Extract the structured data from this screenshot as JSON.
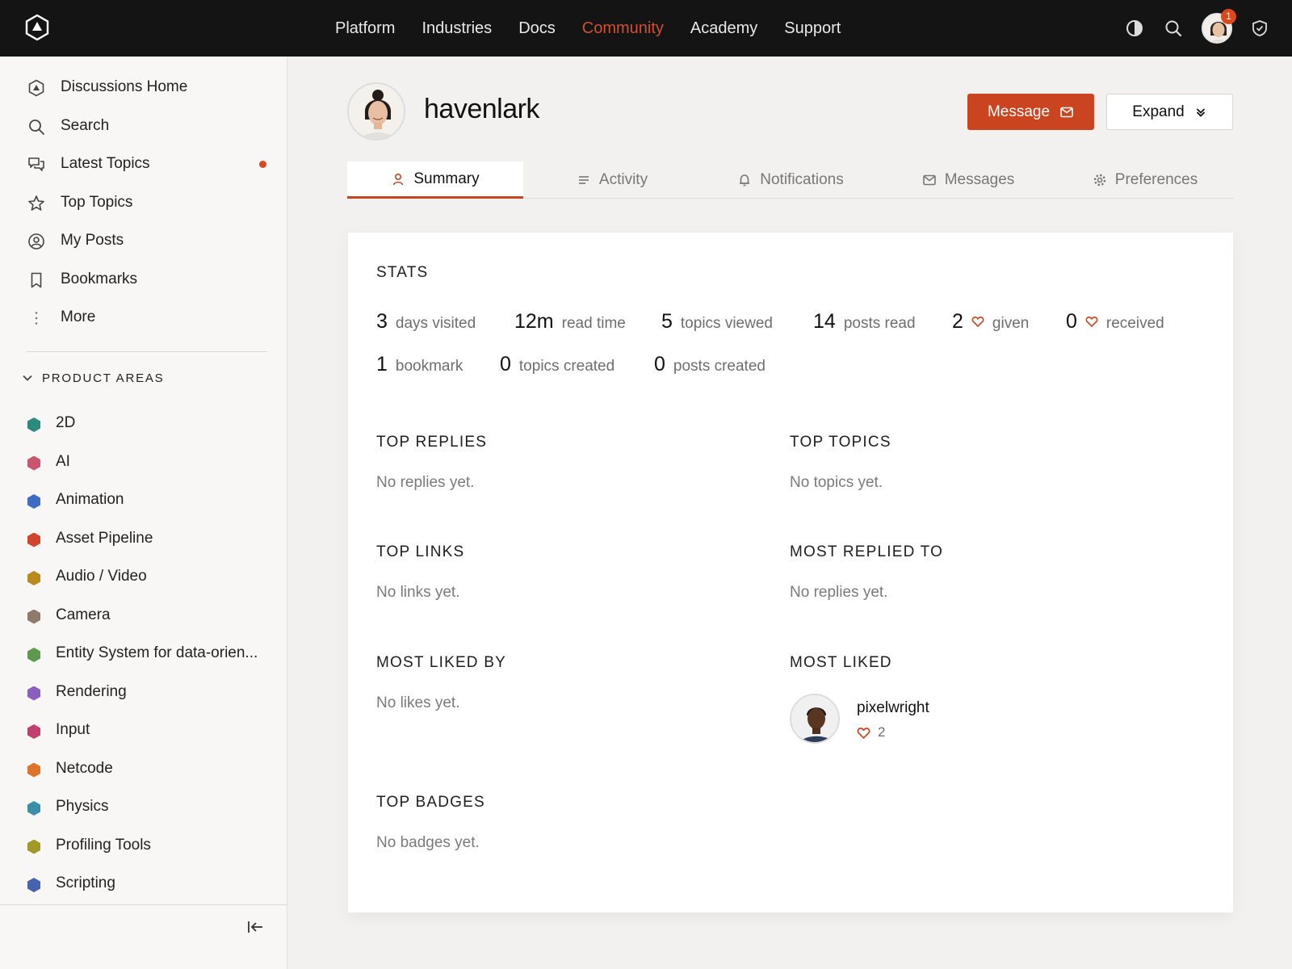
{
  "topnav": {
    "items": [
      "Platform",
      "Industries",
      "Docs",
      "Community",
      "Academy",
      "Support"
    ],
    "active": "Community",
    "notification_count": "1"
  },
  "sidebar": {
    "nav": [
      {
        "label": "Discussions Home",
        "icon": "discussions-home-icon"
      },
      {
        "label": "Search",
        "icon": "search-icon"
      },
      {
        "label": "Latest Topics",
        "icon": "chat-bubbles-icon"
      },
      {
        "label": "Top Topics",
        "icon": "star-icon"
      },
      {
        "label": "My Posts",
        "icon": "user-circle-icon"
      },
      {
        "label": "Bookmarks",
        "icon": "bookmark-icon"
      },
      {
        "label": "More",
        "icon": "more-vertical-icon"
      }
    ],
    "section_title": "PRODUCT AREAS",
    "categories": [
      {
        "label": "2D",
        "color": "#2a8a7b"
      },
      {
        "label": "AI",
        "color": "#c9556f"
      },
      {
        "label": "Animation",
        "color": "#3f6bc2"
      },
      {
        "label": "Asset Pipeline",
        "color": "#d0452c"
      },
      {
        "label": "Audio / Video",
        "color": "#b98a1e"
      },
      {
        "label": "Camera",
        "color": "#8f7b6b"
      },
      {
        "label": "Entity System for data-orien...",
        "color": "#5e9a4c"
      },
      {
        "label": "Rendering",
        "color": "#8a5fc0"
      },
      {
        "label": "Input",
        "color": "#c03f6e"
      },
      {
        "label": "Netcode",
        "color": "#e0732a"
      },
      {
        "label": "Physics",
        "color": "#3a8fa6"
      },
      {
        "label": "Profiling Tools",
        "color": "#a19a27"
      },
      {
        "label": "Scripting",
        "color": "#4763ad"
      }
    ]
  },
  "profile": {
    "username": "havenlark",
    "message_label": "Message",
    "expand_label": "Expand"
  },
  "tabs": [
    "Summary",
    "Activity",
    "Notifications",
    "Messages",
    "Preferences"
  ],
  "stats": {
    "title": "STATS",
    "row1": [
      {
        "n": "3",
        "label": "days visited"
      },
      {
        "n": "12m",
        "label": "read time"
      },
      {
        "n": "5",
        "label": "topics viewed"
      },
      {
        "n": "14",
        "label": "posts read"
      },
      {
        "n": "2",
        "label": "given",
        "heart": true
      },
      {
        "n": "0",
        "label": "received",
        "heart": true
      }
    ],
    "row2": [
      {
        "n": "1",
        "label": "bookmark"
      },
      {
        "n": "0",
        "label": "topics created"
      },
      {
        "n": "0",
        "label": "posts created"
      }
    ]
  },
  "sections": {
    "top_replies": {
      "title": "TOP REPLIES",
      "empty": "No replies yet."
    },
    "top_topics": {
      "title": "TOP TOPICS",
      "empty": "No topics yet."
    },
    "top_links": {
      "title": "TOP LINKS",
      "empty": "No links yet."
    },
    "most_replied_to": {
      "title": "MOST REPLIED TO",
      "empty": "No replies yet."
    },
    "most_liked_by": {
      "title": "MOST LIKED BY",
      "empty": "No likes yet."
    },
    "most_liked": {
      "title": "MOST LIKED",
      "user": "pixelwright",
      "count": "2"
    },
    "top_badges": {
      "title": "TOP BADGES",
      "empty": "No badges yet."
    }
  },
  "colors": {
    "accent": "#c9441f",
    "topbar": "#141414"
  }
}
